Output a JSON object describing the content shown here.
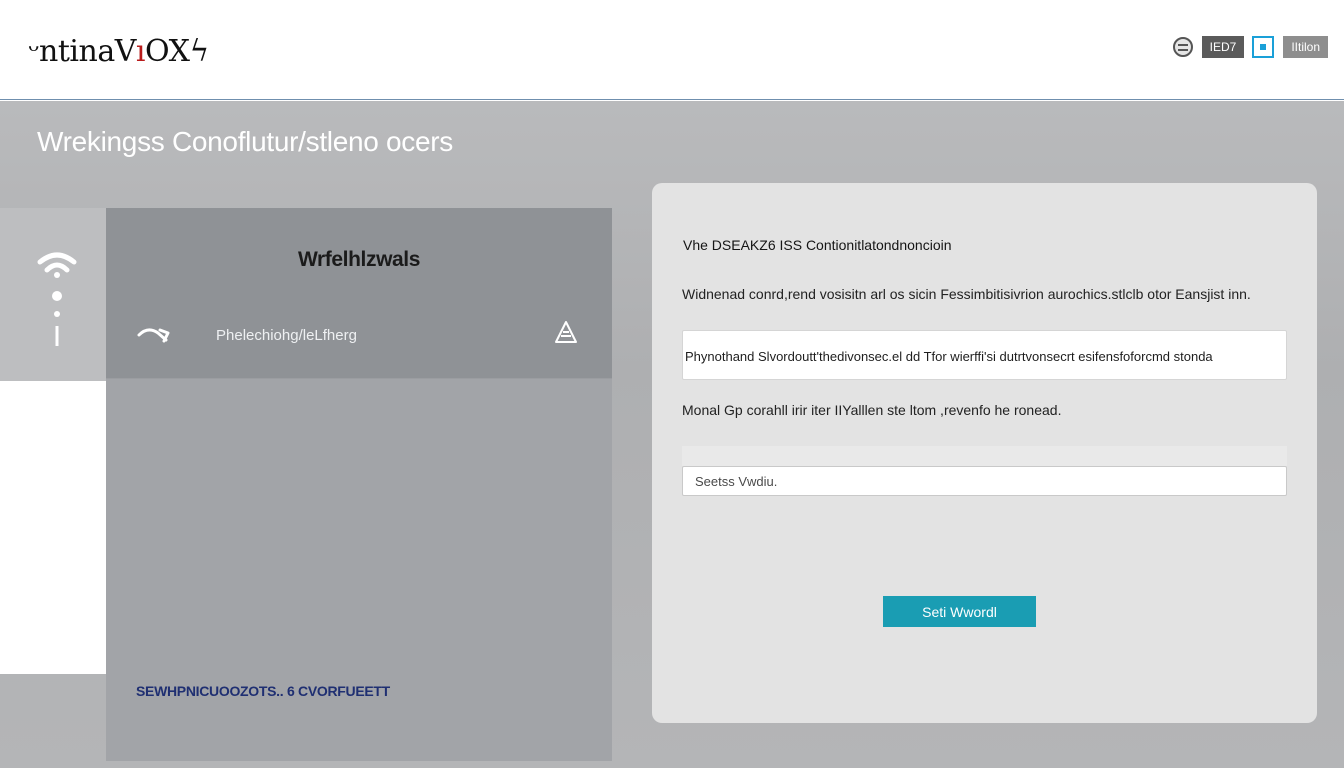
{
  "header": {
    "logo_main": "ᵕntinaV",
    "logo_accent": "ı",
    "logo_end": "OXϟ",
    "btn1_label": "IED7",
    "btn2_label": "IItilon",
    "colors": {
      "accent": "#1aa0d8",
      "border": "#6f8fae"
    }
  },
  "page": {
    "heading": "Wrekingss Conoflutur/stleno ocers"
  },
  "left_panel": {
    "title": "Wrfelhlzwals",
    "row_label": "Phelechiohg/leLfherg",
    "footer": "SEWHPNICUOOZOTS.. 6 CVORFUEETT",
    "icons": [
      "wifi-icon",
      "back-arrow-icon",
      "drop-icon"
    ]
  },
  "card": {
    "title": "Vhe DSEAKZ6 ISS Contionitlatondnoncioin",
    "description": "Widnenad conrd,rend vosisitn arl os sicin Fessimbitisivrion aurochics.stlclb otor Eansjist inn.",
    "field1_value": "Phynothand Slvordoutt'thedivonsec.el dd Tfor wierffi'si dutrtvonsecrt esifensfoforcmd stonda",
    "note": "Monal Gp corahll irir iter IIYalllen ste ltom ,revenfo he ronead.",
    "search_placeholder": "Seetss Vwdiu.",
    "submit_label": "Seti Wwordl",
    "colors": {
      "button": "#1a9db3"
    }
  }
}
